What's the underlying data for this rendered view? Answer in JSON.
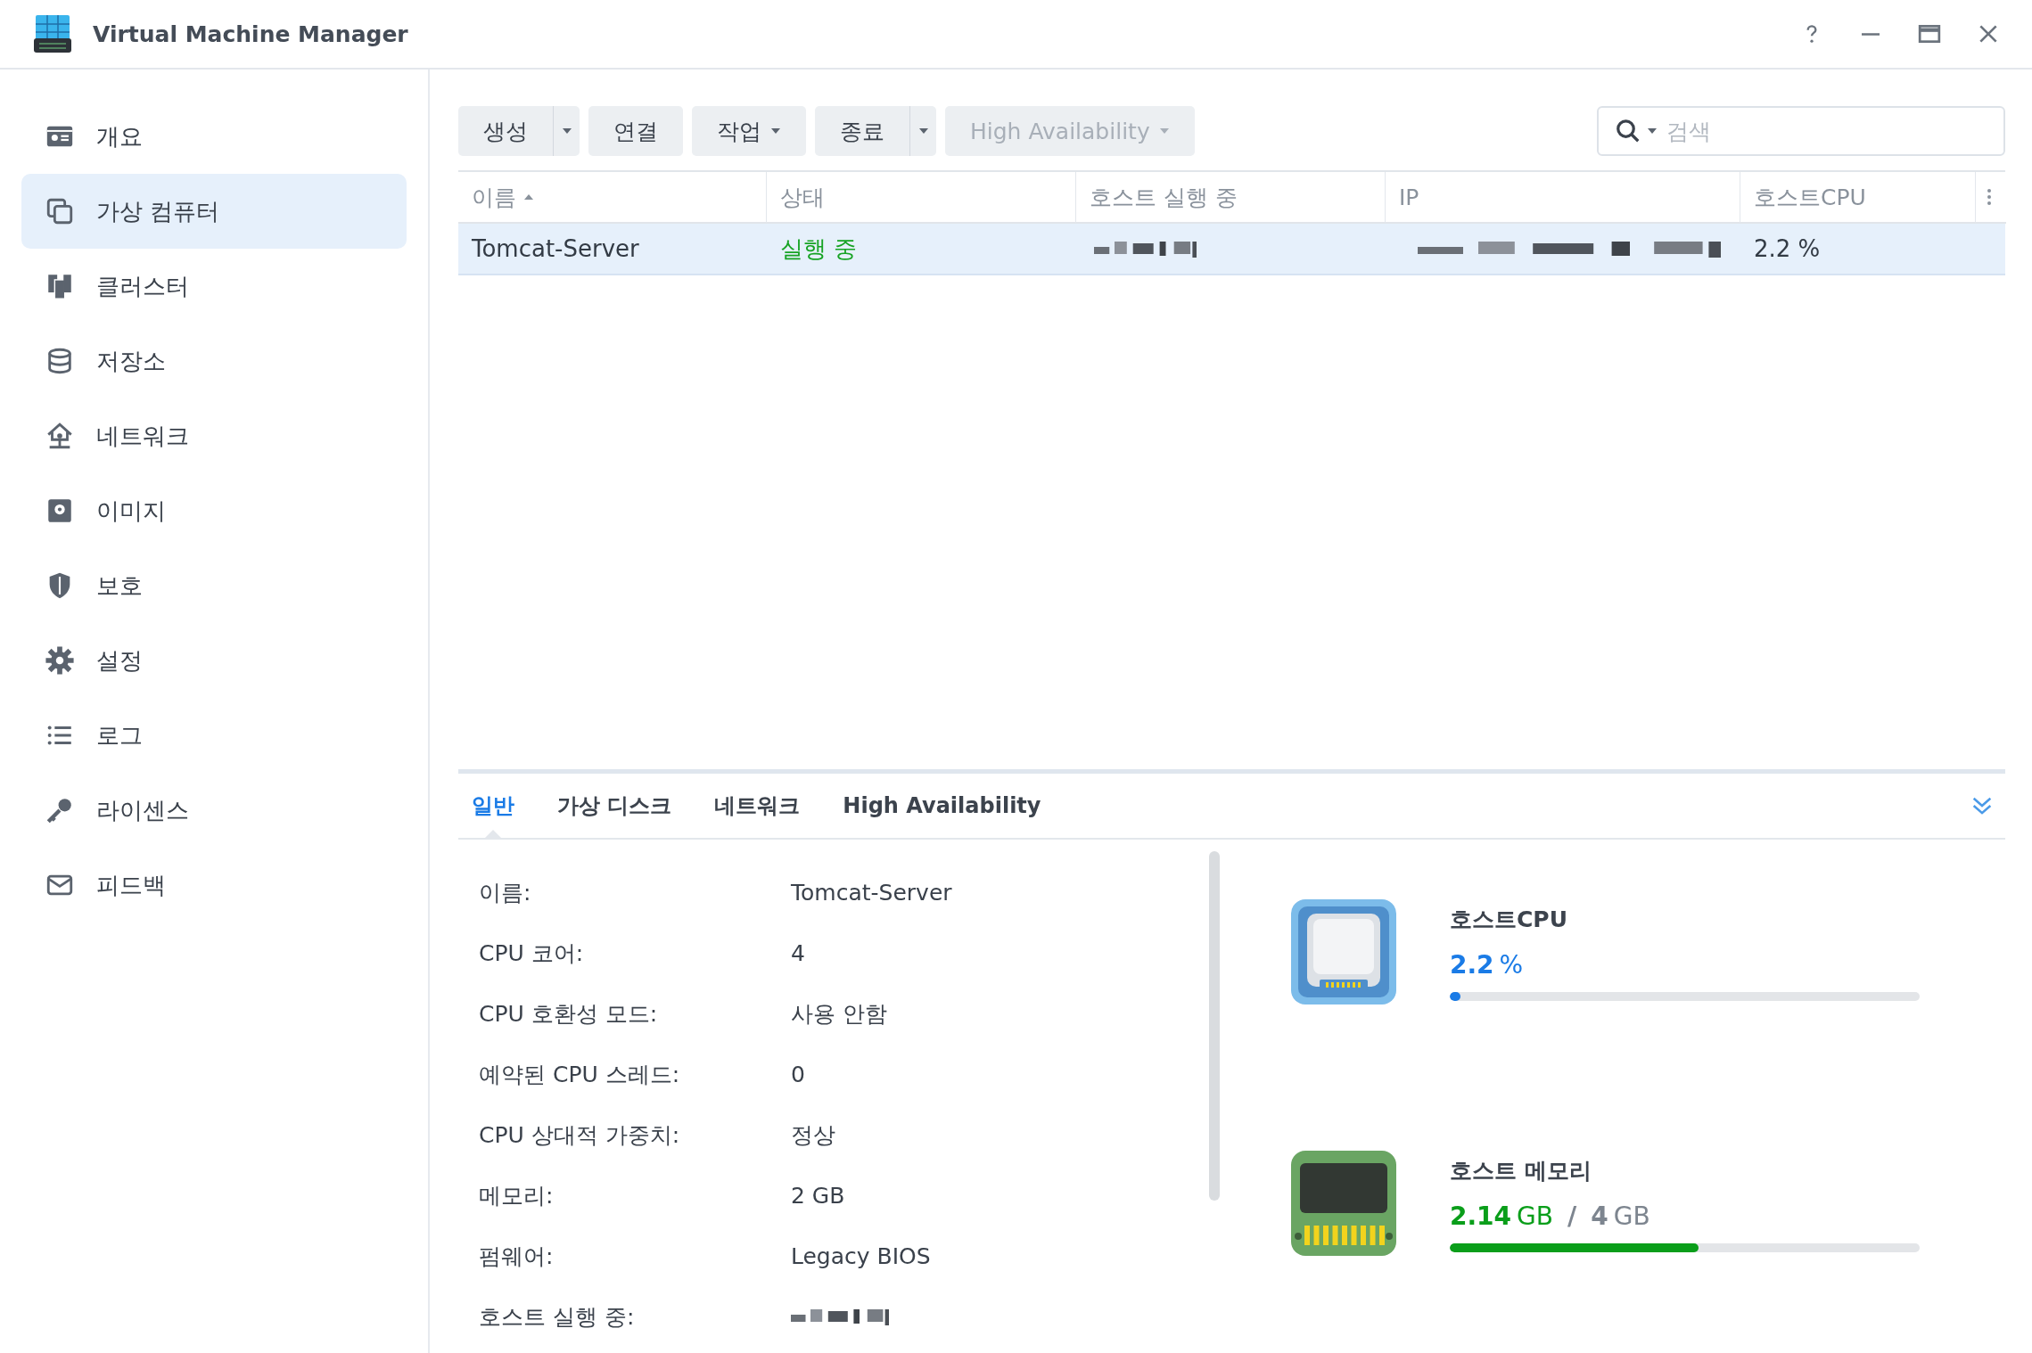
{
  "window": {
    "title": "Virtual Machine Manager"
  },
  "sidebar": {
    "items": [
      {
        "label": "개요",
        "selected": false
      },
      {
        "label": "가상 컴퓨터",
        "selected": true
      },
      {
        "label": "클러스터",
        "selected": false
      },
      {
        "label": "저장소",
        "selected": false
      },
      {
        "label": "네트워크",
        "selected": false
      },
      {
        "label": "이미지",
        "selected": false
      },
      {
        "label": "보호",
        "selected": false
      },
      {
        "label": "설정",
        "selected": false
      },
      {
        "label": "로그",
        "selected": false
      },
      {
        "label": "라이센스",
        "selected": false
      },
      {
        "label": "피드백",
        "selected": false
      }
    ]
  },
  "toolbar": {
    "buttons": [
      {
        "label": "생성",
        "kind": "split",
        "disabled": false
      },
      {
        "label": "연결",
        "kind": "plain",
        "disabled": false
      },
      {
        "label": "작업",
        "kind": "menu",
        "disabled": false
      },
      {
        "label": "종료",
        "kind": "split",
        "disabled": false
      },
      {
        "label": "High Availability",
        "kind": "menu",
        "disabled": true
      }
    ],
    "search": {
      "placeholder": "검색"
    }
  },
  "table": {
    "columns": [
      {
        "label": "이름",
        "sorted": true
      },
      {
        "label": "상태",
        "sorted": false
      },
      {
        "label": "호스트 실행 중",
        "sorted": false
      },
      {
        "label": "IP",
        "sorted": false
      },
      {
        "label": "호스트CPU",
        "sorted": false
      }
    ],
    "rows": [
      {
        "selected": true,
        "cells": [
          {
            "kind": "text",
            "text": "Tomcat-Server"
          },
          {
            "kind": "status",
            "text": "실행 중",
            "color": "#17a324"
          },
          {
            "kind": "redacted"
          },
          {
            "kind": "redacted"
          },
          {
            "kind": "text",
            "text": "2.2 %"
          }
        ]
      }
    ]
  },
  "detail_tabs": [
    {
      "label": "일반",
      "selected": true
    },
    {
      "label": "가상 디스크",
      "selected": false
    },
    {
      "label": "네트워크",
      "selected": false
    },
    {
      "label": "High Availability",
      "selected": false
    }
  ],
  "details": [
    {
      "label": "이름:",
      "kind": "text",
      "value": "Tomcat-Server"
    },
    {
      "label": "CPU 코어:",
      "kind": "text",
      "value": "4"
    },
    {
      "label": "CPU 호환성 모드:",
      "kind": "text",
      "value": "사용 안함"
    },
    {
      "label": "예약된 CPU 스레드:",
      "kind": "text",
      "value": "0"
    },
    {
      "label": "CPU 상대적 가중치:",
      "kind": "text",
      "value": "정상"
    },
    {
      "label": "메모리:",
      "kind": "text",
      "value": "2 GB"
    },
    {
      "label": "펌웨어:",
      "kind": "text",
      "value": "Legacy BIOS"
    },
    {
      "label": "호스트 실행 중:",
      "kind": "redacted"
    }
  ],
  "meters": [
    {
      "kind": "cpu",
      "title": "호스트CPU",
      "value": "2.2",
      "unit": "%",
      "color": "#1a7be6",
      "level": 0.022
    },
    {
      "kind": "memory",
      "title": "호스트 메모리",
      "value": "2.14",
      "unit": "GB",
      "separator": "/",
      "total": "4",
      "total_unit": "GB",
      "color": "#0a9e1a",
      "level": 0.53
    }
  ]
}
